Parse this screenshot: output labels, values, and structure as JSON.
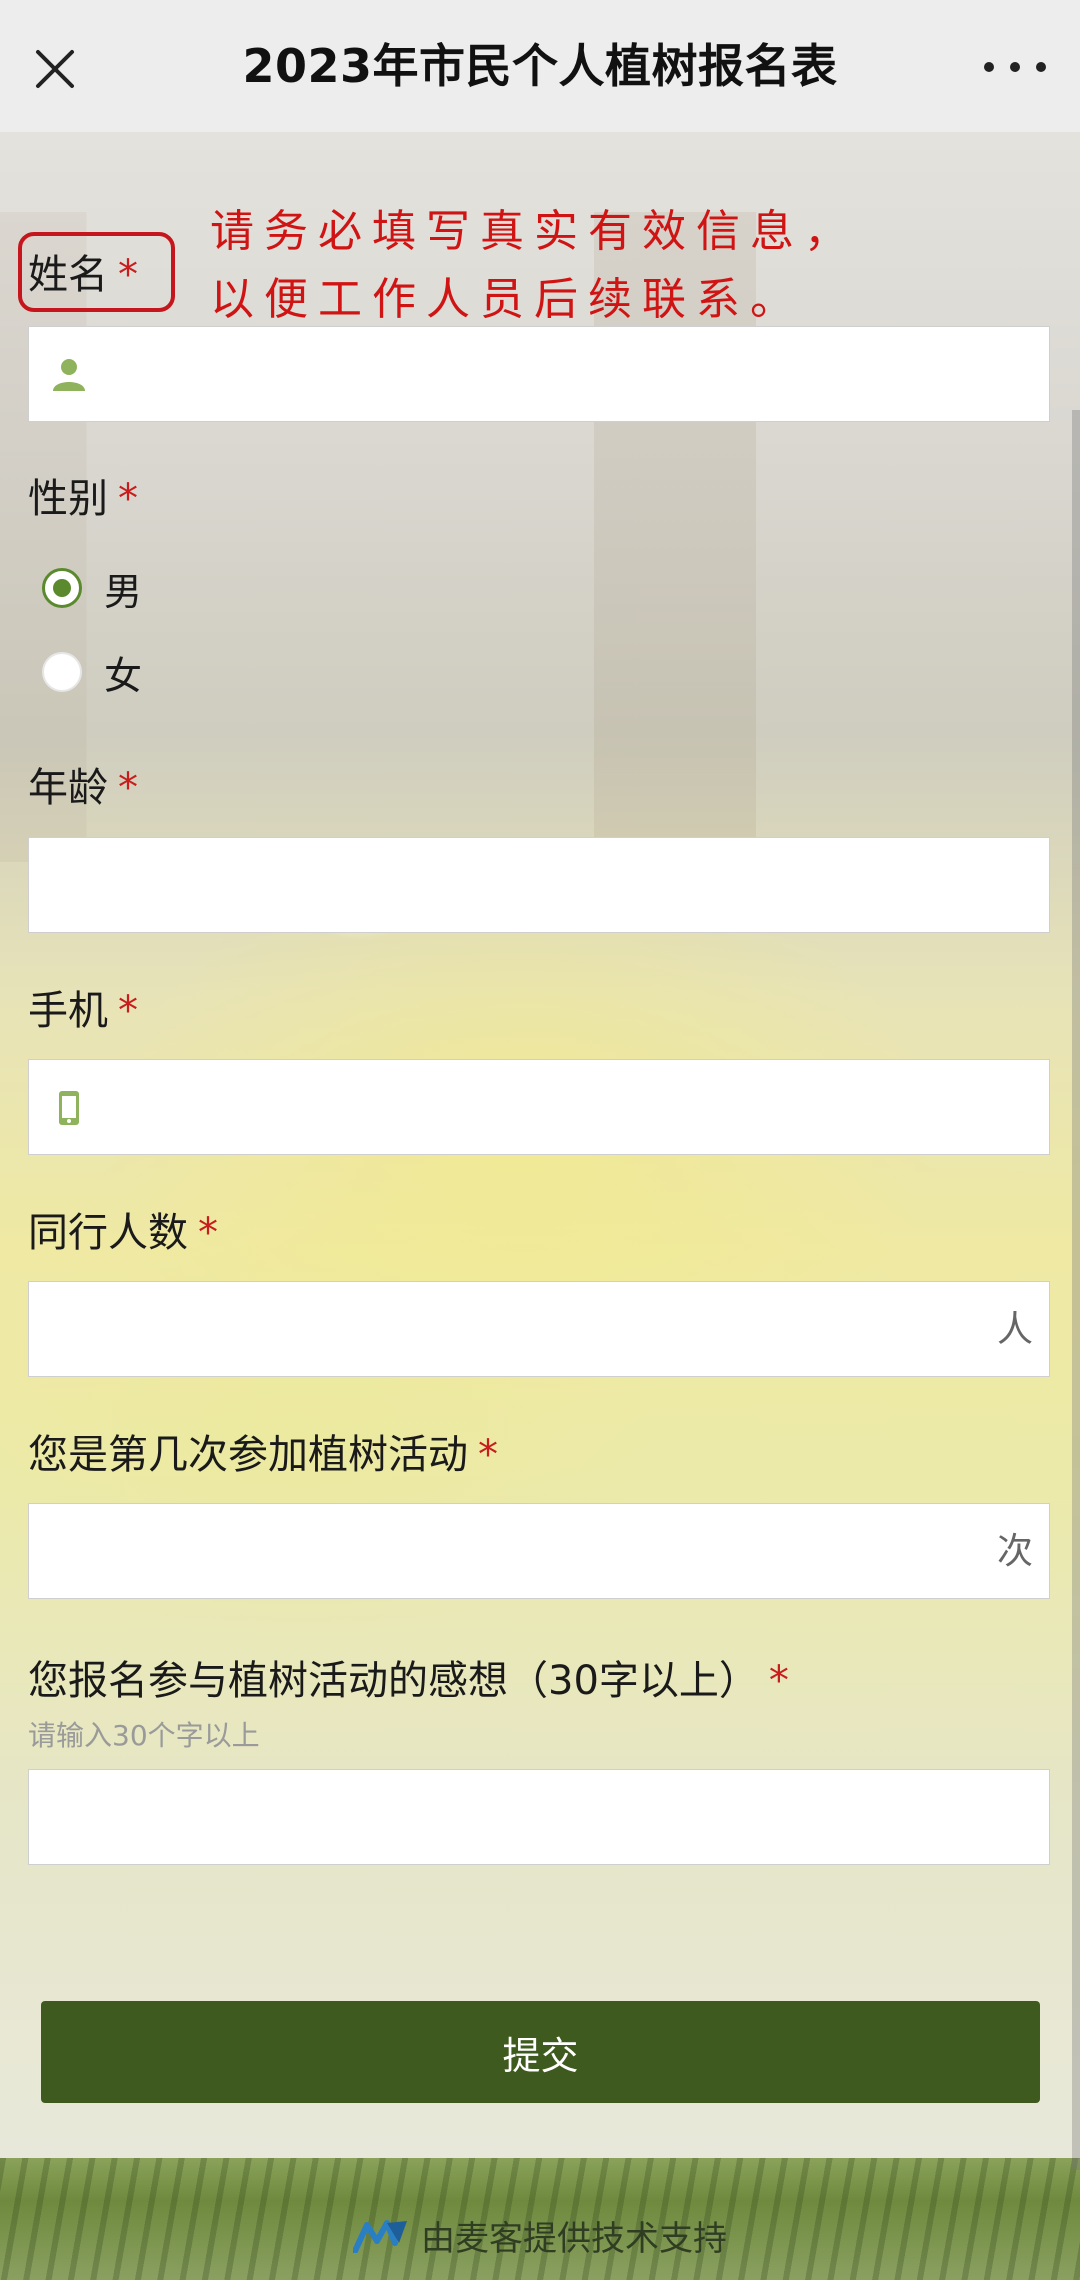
{
  "topbar": {
    "title": "2023年市民个人植树报名表",
    "close_icon": "close-icon",
    "more_icon": "more-icon"
  },
  "annotation": {
    "line1": "请务必填写真实有效信息，",
    "line2": "以便工作人员后续联系。",
    "color": "#d01414"
  },
  "form": {
    "required_mark": "*",
    "name": {
      "label": "姓名",
      "value": "",
      "icon": "person-icon"
    },
    "gender": {
      "label": "性别",
      "options": [
        "男",
        "女"
      ],
      "selected": "男"
    },
    "age": {
      "label": "年龄",
      "value": ""
    },
    "phone": {
      "label": "手机",
      "value": "",
      "icon": "phone-icon"
    },
    "companions": {
      "label": "同行人数",
      "suffix": "人",
      "value": ""
    },
    "times": {
      "label": "您是第几次参加植树活动",
      "suffix": "次",
      "value": ""
    },
    "thoughts": {
      "label": "您报名参与植树活动的感想（30字以上）",
      "hint": "请输入30个字以上",
      "value": ""
    },
    "submit_label": "提交"
  },
  "footer": {
    "text": "由麦客提供技术支持",
    "logo_icon": "mikecrm-logo-icon"
  },
  "colors": {
    "accent": "#5b8a2e",
    "button": "#3f5a1e",
    "required": "#c81d1d"
  }
}
